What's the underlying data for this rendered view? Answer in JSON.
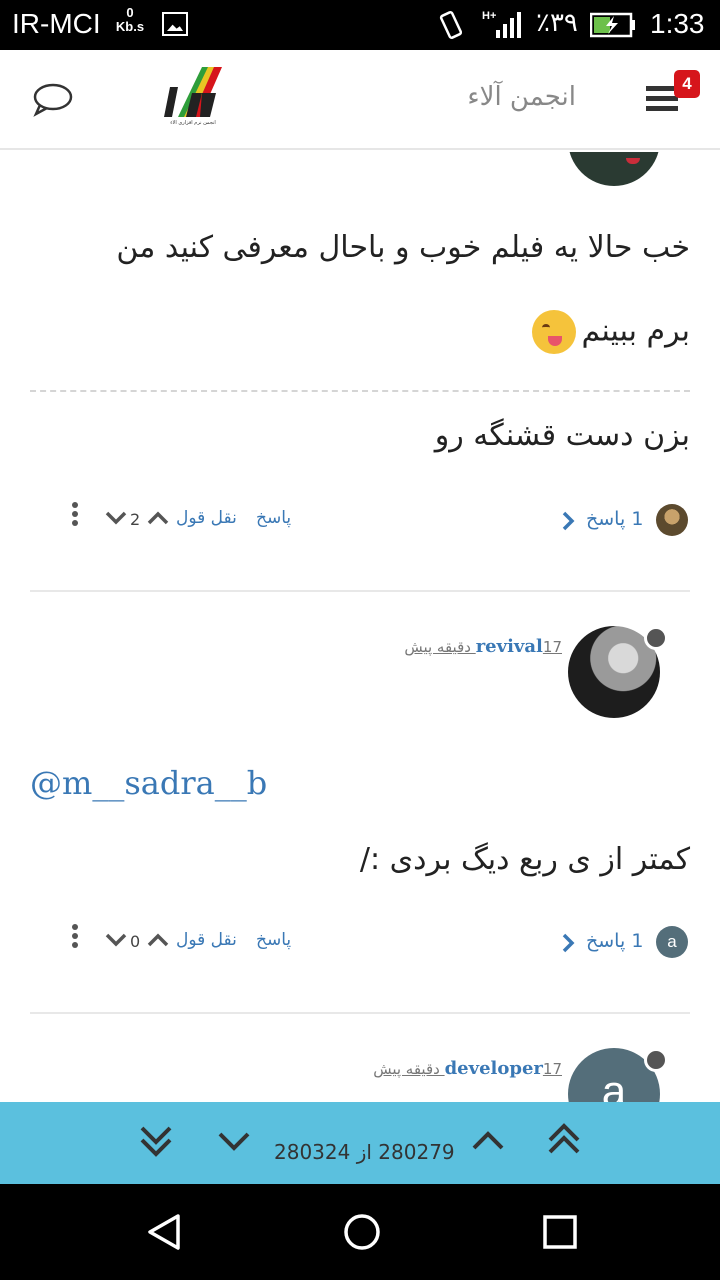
{
  "status_bar": {
    "carrier": "IR-MCI",
    "speed_value": "0",
    "speed_unit": "Kb.s",
    "battery_text": "٪۳۹",
    "time": "1:33"
  },
  "header": {
    "forum_title": "انجمن آلاء",
    "logo_caption": "انجمن نرم افزاری آلاء",
    "notification_count": "4",
    "icons": {
      "chat": "chat-bubble-icon",
      "menu": "hamburger-menu-icon"
    }
  },
  "posts": [
    {
      "body_lines": [
        "خب حالا یه فیلم خوب و باحال معرفی کنید من",
        "برم ببینم"
      ],
      "emoji": "yum-face",
      "signature": "بزن دست قشنگه رو",
      "votes": "2",
      "quote_label": "نقل قول",
      "reply_label": "پاسخ",
      "replies_label": "1 پاسخ"
    },
    {
      "author": "revival",
      "time_ago": "17 دقیقه پیش",
      "mention": "@m__sadra__b",
      "body": "کمتر از ی ربع دیگ بردی :/",
      "votes": "0",
      "quote_label": "نقل قول",
      "reply_label": "پاسخ",
      "replies_label": "1 پاسخ",
      "reply_avatar_letter": "a"
    },
    {
      "author": "developer",
      "time_ago": "17 دقیقه پیش",
      "avatar_letter": "a"
    }
  ],
  "navigator": {
    "index_text": "280279 از 280324",
    "colors": {
      "bar": "#5bc0de"
    }
  },
  "colors": {
    "link": "#3a78b5",
    "badge": "#d6151b",
    "avatar_letter_bg": "#546e7a"
  }
}
